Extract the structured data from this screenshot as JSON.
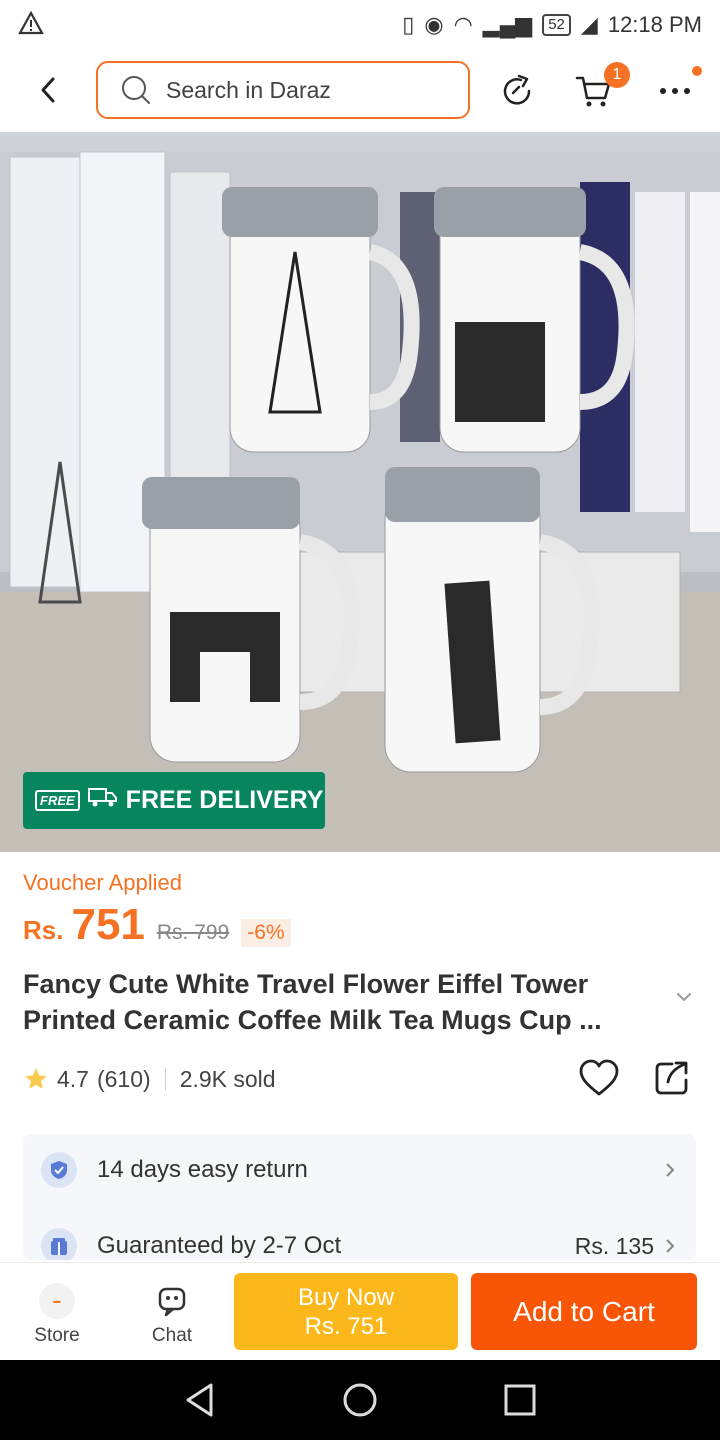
{
  "status_bar": {
    "time": "12:18 PM",
    "battery": "52",
    "warning_icon": "warning-triangle-icon"
  },
  "header": {
    "search_placeholder": "Search in Daraz",
    "cart_count": "1"
  },
  "product": {
    "image_badge": "FREE DELIVERY",
    "image_badge_tag": "FREE",
    "voucher_label": "Voucher Applied",
    "currency": "Rs.",
    "price": "751",
    "original_price": "Rs. 799",
    "discount": "-6%",
    "title": "Fancy Cute White Travel Flower Eiffel Tower Printed  Ceramic Coffee Milk Tea Mugs Cup ...",
    "rating": "4.7",
    "rating_count": "(610)",
    "sold": "2.9K sold"
  },
  "services": {
    "return_text": "14 days easy return",
    "delivery_text": "Guaranteed by 2-7 Oct",
    "delivery_fee": "Rs. 135"
  },
  "bottom_bar": {
    "store_label": "Store",
    "chat_label": "Chat",
    "buy_now_label": "Buy Now",
    "buy_now_price": "Rs. 751",
    "add_to_cart_label": "Add to Cart"
  },
  "colors": {
    "accent": "#f57224",
    "buy_now": "#fcb81a",
    "add_to_cart": "#f85606",
    "free_delivery": "#06855f"
  }
}
